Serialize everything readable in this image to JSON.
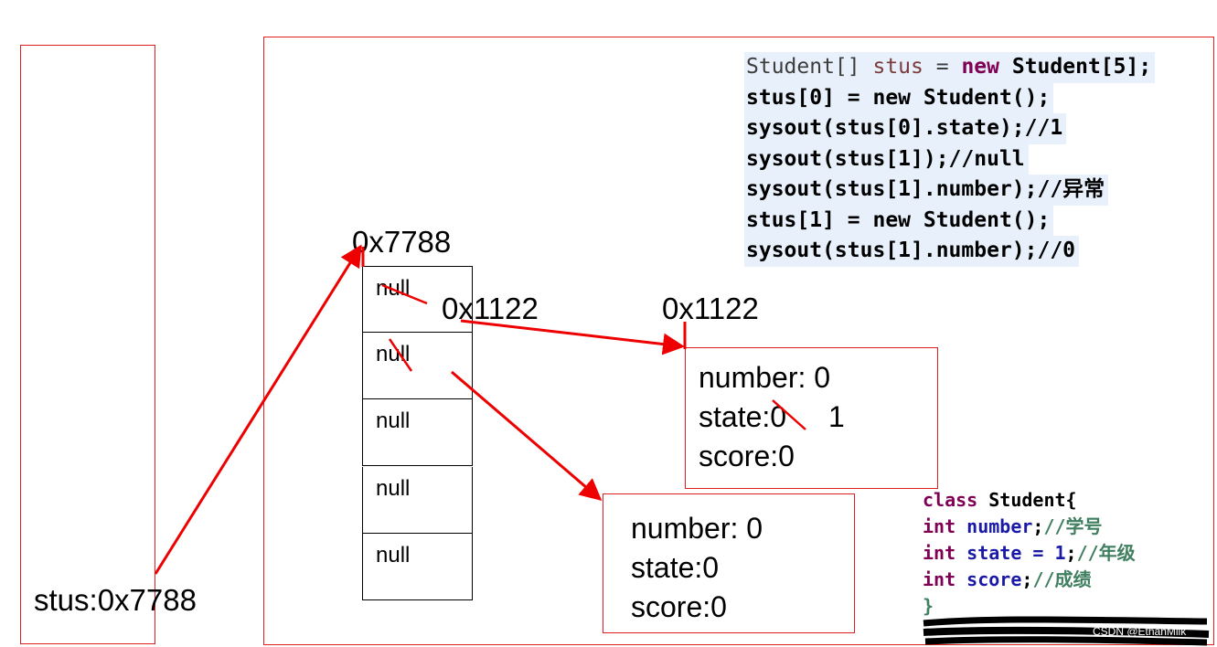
{
  "stack": {
    "label": "stus:0x7788"
  },
  "array": {
    "address": "0x7788",
    "cells": [
      "null",
      "null",
      "null",
      "null",
      "null"
    ],
    "cell0_new_ref": "0x1122"
  },
  "object1": {
    "address": "0x1122",
    "number": "number: 0",
    "state_old": "state:0",
    "state_new": "1",
    "score": "score:0"
  },
  "object2": {
    "number": "number: 0",
    "state": "state:0",
    "score": "score:0"
  },
  "code": {
    "line1": {
      "type": "Student[]",
      "var": "stus",
      "eq": "=",
      "kw": "new",
      "rest": "Student[5];"
    },
    "line2": "stus[0] = new Student();",
    "line3": "sysout(stus[0].state);//1",
    "line4": "sysout(stus[1]);//null",
    "line5": "sysout(stus[1].number);//异常",
    "line6": "stus[1] = new Student();",
    "line7": "sysout(stus[1].number);//0"
  },
  "class_def": {
    "line1": {
      "kw": "class",
      "name": "Student{"
    },
    "line2": {
      "kw": "int",
      "field": "number",
      "rest": ";",
      "comment": "//学号"
    },
    "line3": {
      "kw": "int",
      "field": "state = 1",
      "rest": ";",
      "comment": "//年级"
    },
    "line4": {
      "kw": "int",
      "field": "score",
      "rest": ";",
      "comment": "//成绩"
    },
    "line5": "}"
  },
  "watermark": "CSDN @EthanMilk",
  "colors": {
    "accent": "#e02020",
    "arrow": "#ee0000"
  }
}
